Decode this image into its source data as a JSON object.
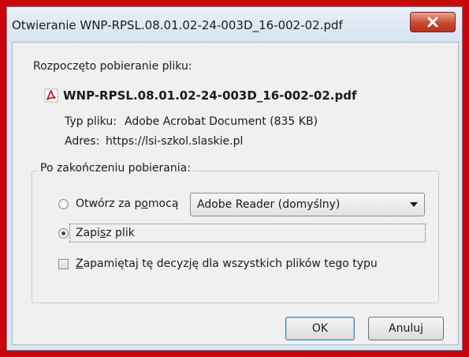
{
  "window": {
    "title": "Otwieranie WNP-RPSL.08.01.02-24-003D_16-002-02.pdf"
  },
  "download": {
    "intro": "Rozpoczęto pobieranie pliku:",
    "filename": "WNP-RPSL.08.01.02-24-003D_16-002-02.pdf",
    "type_label": "Typ pliku:",
    "type_value": "Adobe Acrobat Document (835 KB)",
    "address_label": "Adres:",
    "address_value": "https://lsi-szkol.slaskie.pl"
  },
  "after_download": {
    "legend": "Po zakończeniu pobierania:",
    "open_with": {
      "label_pre": "Otwórz za p",
      "label_accel": "o",
      "label_post": "mocą",
      "checked": false
    },
    "app_select": {
      "value": "Adobe Reader  (domyślny)"
    },
    "save_file": {
      "label_pre": "Zapi",
      "label_accel": "s",
      "label_post": "z plik",
      "checked": true
    },
    "remember": {
      "label_accel": "Z",
      "label_post": "apamiętaj tę decyzję dla wszystkich plików tego typu",
      "checked": false
    }
  },
  "buttons": {
    "ok": "OK",
    "cancel": "Anuluj"
  },
  "colors": {
    "frame": "#c8050b",
    "close_button": "#c9472f",
    "pdf_icon": "#d0021b"
  }
}
